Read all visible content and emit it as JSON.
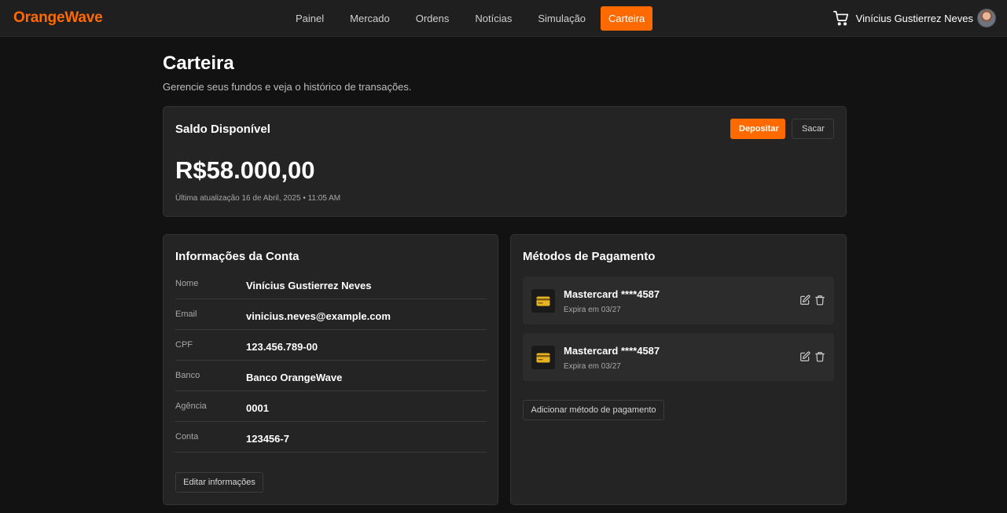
{
  "app": {
    "logo": "OrangeWave"
  },
  "nav": {
    "items": [
      {
        "label": "Painel",
        "active": false
      },
      {
        "label": "Mercado",
        "active": false
      },
      {
        "label": "Ordens",
        "active": false
      },
      {
        "label": "Notícias",
        "active": false
      },
      {
        "label": "Simulação",
        "active": false
      },
      {
        "label": "Carteira",
        "active": true
      }
    ],
    "user_name": "Vinícius Gustierrez Neves",
    "cart_icon": "cart-icon"
  },
  "page": {
    "title": "Carteira",
    "subtitle": "Gerencie seus fundos e veja o histórico de transações."
  },
  "balance": {
    "title": "Saldo Disponível",
    "deposit_label": "Depositar",
    "withdraw_label": "Sacar",
    "amount": "R$58.000,00",
    "updated": "Última atualização 16 de Abril, 2025 • 11:05 AM"
  },
  "account": {
    "title": "Informações da Conta",
    "rows": [
      {
        "label": "Nome",
        "value": "Vinícius Gustierrez Neves"
      },
      {
        "label": "Email",
        "value": "vinicius.neves@example.com"
      },
      {
        "label": "CPF",
        "value": "123.456.789-00"
      },
      {
        "label": "Banco",
        "value": "Banco OrangeWave"
      },
      {
        "label": "Agência",
        "value": "0001"
      },
      {
        "label": "Conta",
        "value": "123456-7"
      }
    ],
    "edit_label": "Editar informações"
  },
  "payment": {
    "title": "Métodos de Pagamento",
    "methods": [
      {
        "name": "Mastercard ****4587",
        "expiry": "Expira em 03/27"
      },
      {
        "name": "Mastercard ****4587",
        "expiry": "Expira em 03/27"
      }
    ],
    "add_label": "Adicionar método de pagamento"
  },
  "colors": {
    "accent": "#ff6a00",
    "background": "#121212",
    "card": "#242424",
    "card_icon": "#e6b422"
  }
}
